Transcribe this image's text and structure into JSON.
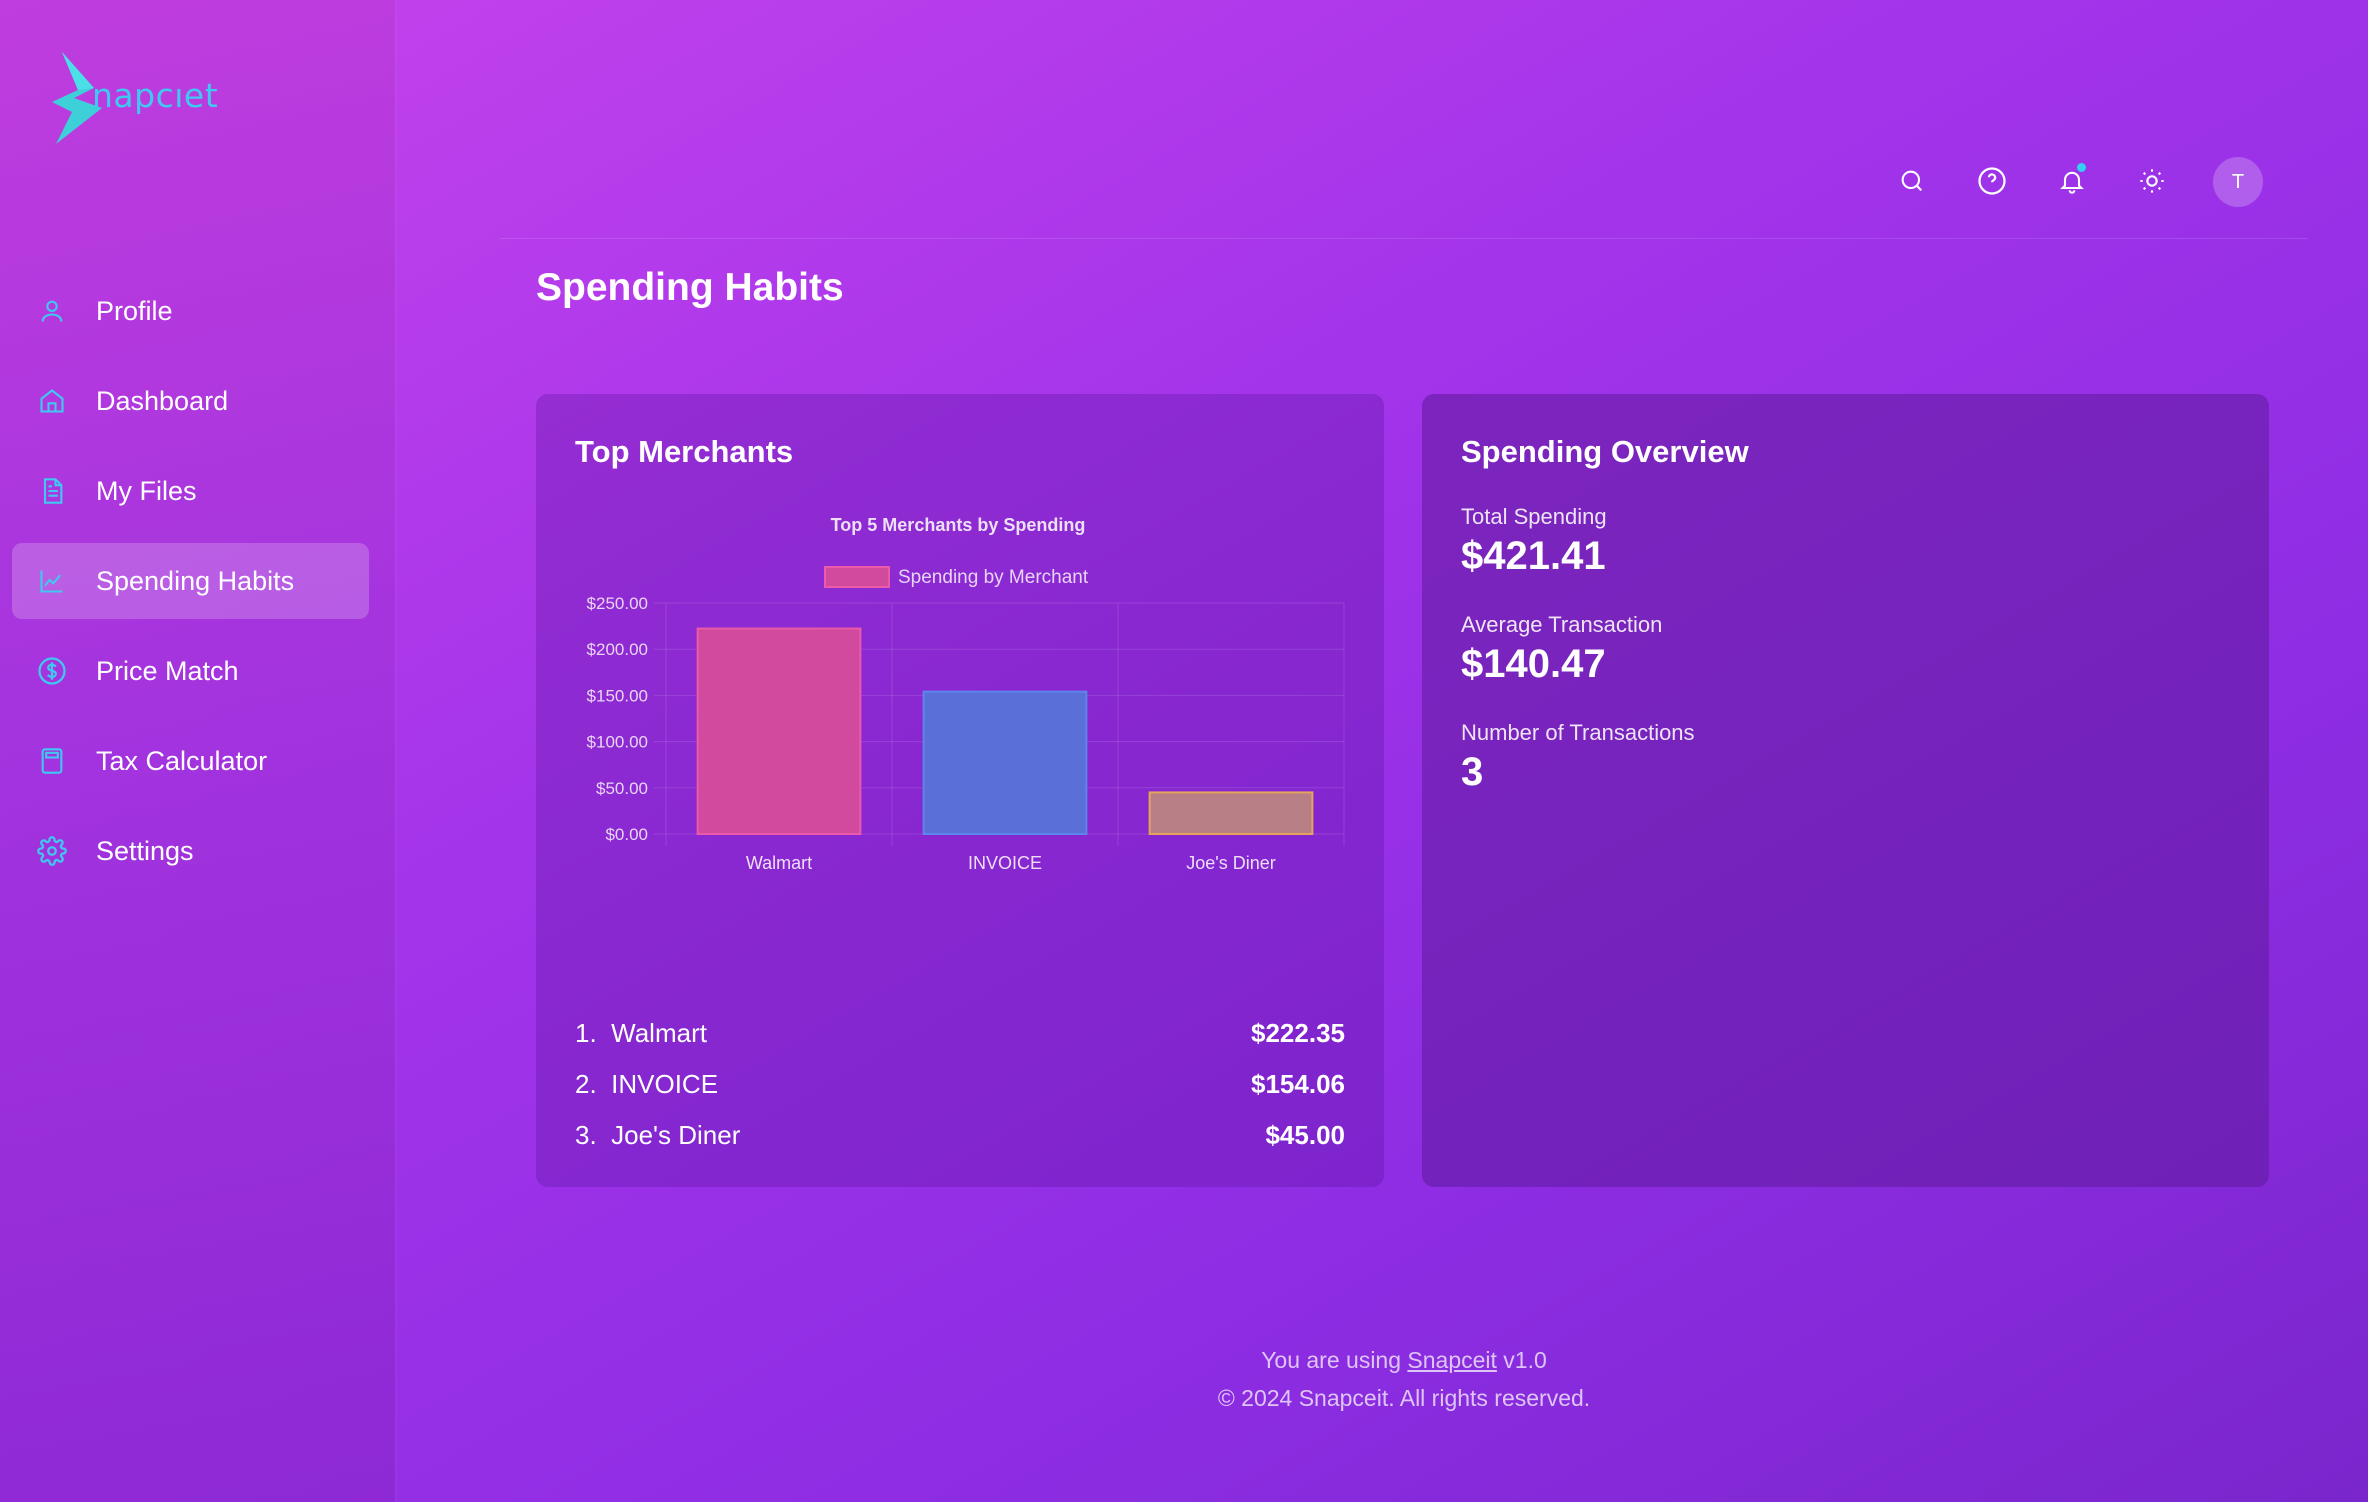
{
  "brand": {
    "name": "napcıet"
  },
  "sidebar": {
    "items": [
      {
        "label": "Profile",
        "icon": "user-icon"
      },
      {
        "label": "Dashboard",
        "icon": "home-icon"
      },
      {
        "label": "My Files",
        "icon": "file-icon"
      },
      {
        "label": "Spending Habits",
        "icon": "chart-line-icon",
        "active": true
      },
      {
        "label": "Price Match",
        "icon": "dollar-circle-icon"
      },
      {
        "label": "Tax Calculator",
        "icon": "calculator-icon"
      },
      {
        "label": "Settings",
        "icon": "gear-icon"
      }
    ]
  },
  "header": {
    "icons": [
      "search-icon",
      "help-icon",
      "bell-icon",
      "sun-icon"
    ],
    "avatar_initial": "T"
  },
  "page": {
    "title": "Spending Habits"
  },
  "top_merchants": {
    "title": "Top Merchants",
    "list": [
      {
        "rank": "1.",
        "name": "Walmart",
        "amount": "$222.35"
      },
      {
        "rank": "2.",
        "name": "INVOICE",
        "amount": "$154.06"
      },
      {
        "rank": "3.",
        "name": "Joe's Diner",
        "amount": "$45.00"
      }
    ]
  },
  "chart_data": {
    "type": "bar",
    "title": "Top 5 Merchants by Spending",
    "categories": [
      "Walmart",
      "INVOICE",
      "Joe's Diner"
    ],
    "series": [
      {
        "name": "Spending by Merchant",
        "values": [
          222.35,
          154.06,
          45.0
        ]
      }
    ],
    "colors": [
      "#d14a9e",
      "#5a6fd8",
      "#b87f86"
    ],
    "border_colors": [
      "#ea5aa8",
      "#5d86ea",
      "#e6a45a"
    ],
    "ylim": [
      0,
      250
    ],
    "yticks": [
      "$0.00",
      "$50.00",
      "$100.00",
      "$150.00",
      "$200.00",
      "$250.00"
    ],
    "ytick_values": [
      0,
      50,
      100,
      150,
      200,
      250
    ],
    "grid": true,
    "legend": "top"
  },
  "overview": {
    "title": "Spending Overview",
    "total_label": "Total Spending",
    "total_value": "$421.41",
    "avg_label": "Average Transaction",
    "avg_value": "$140.47",
    "count_label": "Number of Transactions",
    "count_value": "3"
  },
  "footer": {
    "prefix": "You are using ",
    "link": "Snapceit",
    "suffix": " v1.0",
    "copyright": "© 2024 Snapceit. All rights reserved."
  }
}
